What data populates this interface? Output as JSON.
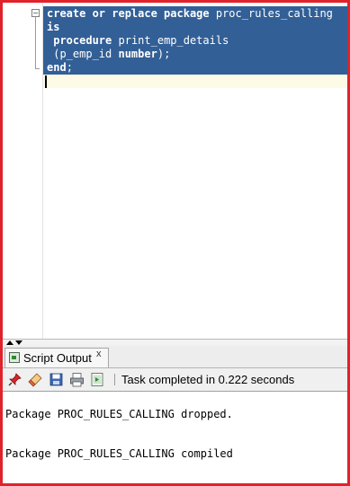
{
  "editor": {
    "lines": [
      [
        {
          "t": "create or replace package",
          "k": true
        },
        {
          "t": " proc_rules_calling",
          "k": false
        }
      ],
      [
        {
          "t": "is",
          "k": true
        }
      ],
      [
        {
          "t": " ",
          "k": false
        },
        {
          "t": "procedure",
          "k": true
        },
        {
          "t": " print_emp_details",
          "k": false
        }
      ],
      [
        {
          "t": " (p_emp_id ",
          "k": false
        },
        {
          "t": "number",
          "k": true
        },
        {
          "t": ");",
          "k": false
        }
      ],
      [
        {
          "t": "end",
          "k": true
        },
        {
          "t": ";",
          "k": false
        }
      ]
    ],
    "fold_symbol": "−",
    "selection_color": "#325f96"
  },
  "panel": {
    "tab_label": "Script Output",
    "tab_close": "x",
    "toolbar": {
      "buttons": [
        "pin-icon",
        "eraser-icon",
        "save-icon",
        "print-icon",
        "export-icon"
      ],
      "status": "Task completed in 0.222 seconds"
    },
    "output": [
      "Package PROC_RULES_CALLING dropped.",
      "Package PROC_RULES_CALLING compiled"
    ]
  },
  "frame_color": "#e0222a"
}
